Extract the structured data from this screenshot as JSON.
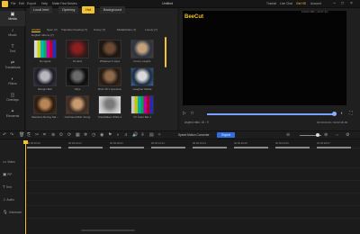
{
  "app": {
    "menu": [
      "File",
      "Edit",
      "Export",
      "Help",
      "Make Fast Movies"
    ],
    "document_title": "Untitled",
    "top_right": [
      "Tutorial",
      "Live Chat",
      "Get HD",
      "Account"
    ],
    "window_controls": [
      "minimize-icon",
      "maximize-icon",
      "close-icon"
    ]
  },
  "sidebar": {
    "items": [
      {
        "label": "Media",
        "icon": "folder-icon",
        "glyph": "▣"
      },
      {
        "label": "Music",
        "icon": "music-icon",
        "glyph": "♪"
      },
      {
        "label": "Text",
        "icon": "text-icon",
        "glyph": "T"
      },
      {
        "label": "Transitions",
        "icon": "transition-icon",
        "glyph": "⇄"
      },
      {
        "label": "Filters",
        "icon": "filter-icon",
        "glyph": "◐"
      },
      {
        "label": "Overlays",
        "icon": "overlay-icon",
        "glyph": "◫"
      },
      {
        "label": "Elements",
        "icon": "element-icon",
        "glyph": "✦"
      }
    ],
    "active": "Media"
  },
  "media": {
    "tabs": [
      "Local Intel",
      "Opening",
      "Hot",
      "Background"
    ],
    "active_tab": "Hot",
    "categories": [
      "All (63)",
      "Spec (7)",
      "Transition Feeling (7)",
      "Funny (7)",
      "Multiplicities (7)",
      "Lonely (7)",
      "English Idioms (7)"
    ],
    "active_category": "All (63)",
    "thumbnails": [
      {
        "label": "No signal",
        "colors": [
          "#d9d9d9",
          "#d4d100",
          "#00b9c4",
          "#00b34b",
          "#c800bd",
          "#c30020",
          "#1d31c8"
        ]
      },
      {
        "label": "No End",
        "colors": [
          "#3a1a1a",
          "#8b1e1e",
          "#d94a2b",
          "#1c1c1c"
        ]
      },
      {
        "label": "Whatever it says",
        "colors": [
          "#1a1410",
          "#6b4a34",
          "#2c2018"
        ]
      },
      {
        "label": "Funny Laughs",
        "colors": [
          "#2a3344",
          "#c4a27c",
          "#4a4035"
        ]
      },
      {
        "label": "Bangin Bell",
        "colors": [
          "#1b1b24",
          "#b9b6c0",
          "#383846"
        ]
      },
      {
        "label": "Ollys",
        "colors": [
          "#0d0d0d",
          "#6a6a6a",
          "#1f1f1f"
        ]
      },
      {
        "label": "Bruh Oh's Question",
        "colors": [
          "#251a12",
          "#8e6a4c",
          "#3d2a1c"
        ]
      },
      {
        "label": "Laughter Media",
        "colors": [
          "#1a2a40",
          "#d9d9d9",
          "#3a6ea5"
        ]
      },
      {
        "label": "Mentions Boring Sat...",
        "colors": [
          "#2a1a10",
          "#b88455",
          "#4a2e1a"
        ]
      },
      {
        "label": "Confused Rick Young",
        "colors": [
          "#3a2a20",
          "#c79a70",
          "#5a3a28"
        ]
      },
      {
        "label": "Snowflakes White 2",
        "colors": [
          "#bdbdbd",
          "#7a7a7a",
          "#e8e8e8"
        ]
      },
      {
        "label": "TV Color Bar 1",
        "colors": [
          "#c8c8c8",
          "#c6c300",
          "#00aeb8",
          "#00a846",
          "#bb00b0",
          "#b4001c",
          "#1c2fbb"
        ]
      }
    ]
  },
  "preview": {
    "resolution": "1920x1080 | 29.97 fps",
    "brand": "BeeCut",
    "aspect_label": "Aspect ratio: 16 : 9",
    "time": "00:00:00.00 / 00:00:00.00",
    "progress": 1.0
  },
  "timeline": {
    "speed_text": "Speed Motion Converter",
    "export_label": "Export",
    "ruler_labels": [
      "00:00:00.00",
      "00:00:04.01",
      "00:00:08.02",
      "00:00:12.03",
      "00:00:16.04",
      "00:00:20.05",
      "00:00:24.06",
      "00:00:28.07"
    ],
    "tracks": [
      {
        "label": "Video",
        "icon": "video-icon",
        "glyph": "▭"
      },
      {
        "label": "PiP",
        "icon": "pip-icon",
        "glyph": "▣"
      },
      {
        "label": "Text",
        "icon": "text-icon",
        "glyph": "T"
      },
      {
        "label": "Audio",
        "icon": "audio-icon",
        "glyph": "♫"
      },
      {
        "label": "Voiceover",
        "icon": "microphone-icon",
        "glyph": "🎙"
      }
    ]
  },
  "colors": {
    "accent": "#f2c230",
    "export_blue": "#2f6de0",
    "seek_blue": "#7aa0ff"
  }
}
